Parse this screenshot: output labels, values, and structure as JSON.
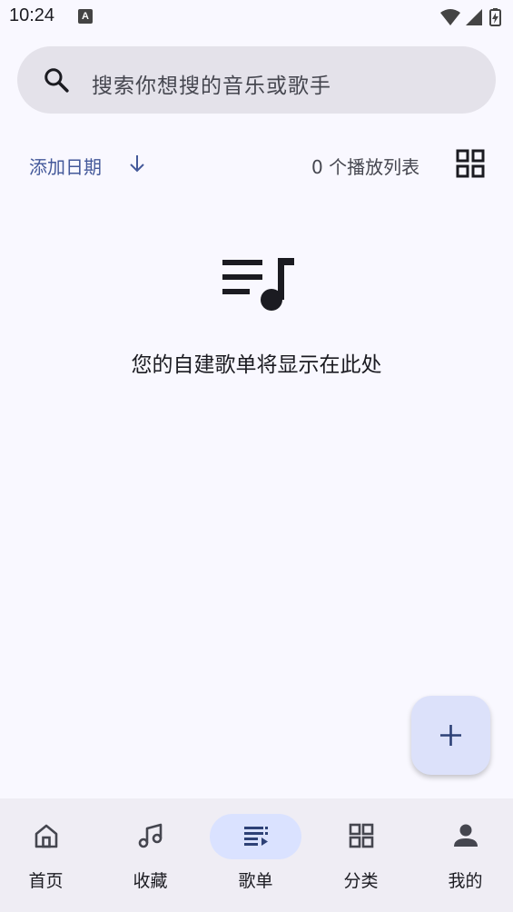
{
  "status_bar": {
    "time": "10:24",
    "notification_badge": "A"
  },
  "search": {
    "placeholder": "搜索你想搜的音乐或歌手"
  },
  "sort": {
    "label": "添加日期",
    "count_label": "0 个播放列表"
  },
  "empty_state": {
    "message": "您的自建歌单将显示在此处"
  },
  "fab": {
    "icon": "add-icon"
  },
  "bottom_nav": {
    "items": [
      {
        "label": "首页",
        "icon": "home-icon",
        "active": false
      },
      {
        "label": "收藏",
        "icon": "music-note-icon",
        "active": false
      },
      {
        "label": "歌单",
        "icon": "playlist-icon",
        "active": true
      },
      {
        "label": "分类",
        "icon": "grid-icon",
        "active": false
      },
      {
        "label": "我的",
        "icon": "person-icon",
        "active": false
      }
    ]
  },
  "colors": {
    "accent": "#44599a",
    "background": "#f9f8ff",
    "nav_active": "#dae2ff",
    "fab": "#dce1fa"
  }
}
